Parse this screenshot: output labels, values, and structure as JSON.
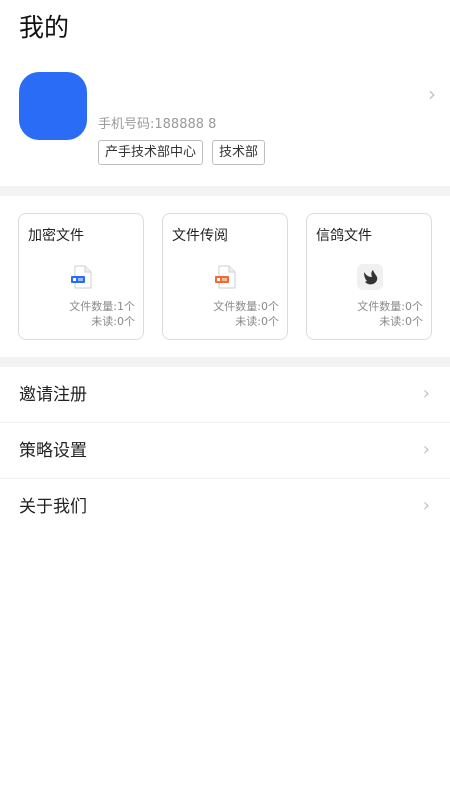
{
  "page": {
    "title": "我的"
  },
  "profile": {
    "phone": "手机号码:188888 8",
    "tags": [
      "产手技术部中心",
      "技术部"
    ],
    "avatar_color": "#2a6cf6",
    "chevron": "chevron-right-icon"
  },
  "cards": [
    {
      "title": "加密文件",
      "icon": "encrypted-file-icon",
      "count": "文件数量:1个",
      "unread": "未读:0个"
    },
    {
      "title": "文件传阅",
      "icon": "circulate-file-icon",
      "count": "文件数量:0个",
      "unread": "未读:0个"
    },
    {
      "title": "信鸽文件",
      "icon": "pigeon-icon",
      "count": "文件数量:0个",
      "unread": "未读:0个"
    }
  ],
  "menu": {
    "items": [
      {
        "label": "邀请注册"
      },
      {
        "label": "策略设置"
      },
      {
        "label": "关于我们"
      }
    ]
  },
  "colors": {
    "accent": "#2a6cf6",
    "divider": "#f3f3f3",
    "orange": "#f06a35"
  }
}
